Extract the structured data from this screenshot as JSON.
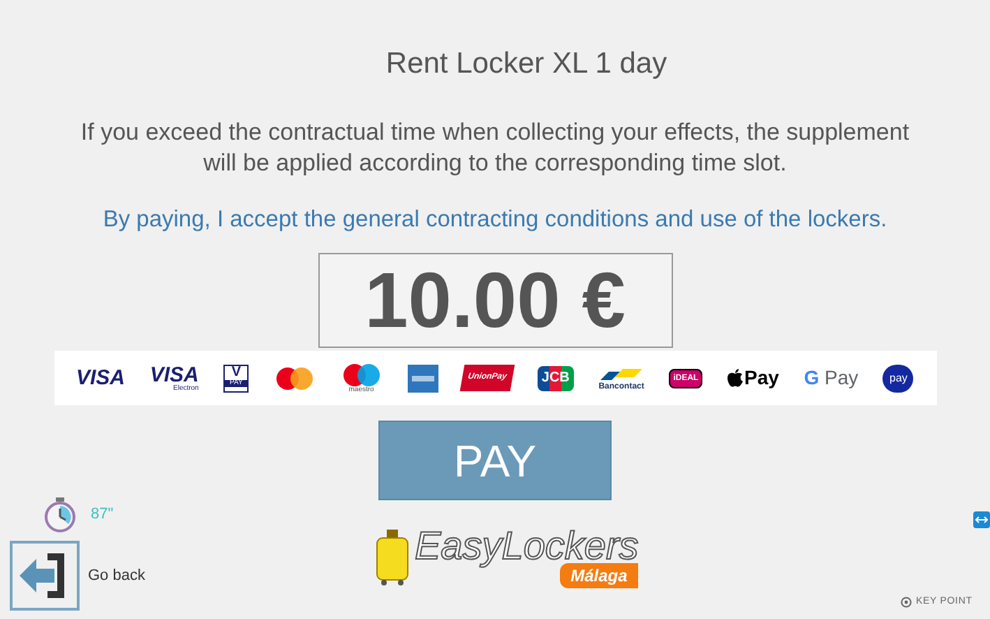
{
  "title": "Rent Locker XL 1 day",
  "notice": "If you exceed the contractual time when collecting your effects, the supplement will be applied according to the corresponding time slot.",
  "terms": "By paying, I accept the general contracting conditions and use of the lockers.",
  "amount": "10.00 €",
  "payment_methods": [
    {
      "kind": "visa",
      "text": "VISA"
    },
    {
      "kind": "visa_electron",
      "text": "VISA",
      "sub": "Electron"
    },
    {
      "kind": "vpay",
      "text": "V",
      "sub": "PAY"
    },
    {
      "kind": "mastercard"
    },
    {
      "kind": "maestro",
      "sub": "maestro"
    },
    {
      "kind": "amex"
    },
    {
      "kind": "unionpay",
      "text": "UnionPay"
    },
    {
      "kind": "jcb",
      "text": "JCB"
    },
    {
      "kind": "bancontact",
      "sub": "Bancontact"
    },
    {
      "kind": "ideal",
      "text": "iDEAL"
    },
    {
      "kind": "applepay",
      "text": "Pay"
    },
    {
      "kind": "googlepay",
      "text": "G",
      "sub": "Pay"
    },
    {
      "kind": "samsungpay",
      "text": "pay"
    }
  ],
  "pay_button": "PAY",
  "timer": "87\"",
  "back_button": "Go back",
  "brand": {
    "name": "EasyLockers",
    "city": "Málaga"
  },
  "footer": "KEY POINT"
}
